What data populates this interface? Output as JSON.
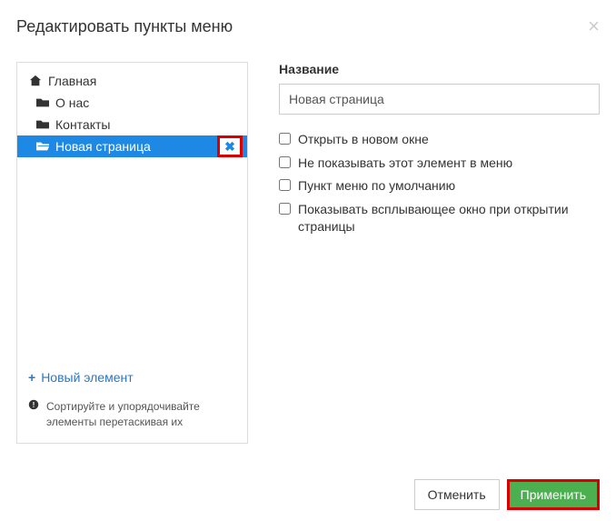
{
  "modal": {
    "title": "Редактировать пункты меню"
  },
  "tree": {
    "items": [
      {
        "label": "Главная"
      },
      {
        "label": "О нас"
      },
      {
        "label": "Контакты"
      },
      {
        "label": "Новая страница"
      }
    ],
    "new_element": "Новый элемент",
    "hint": "Сортируйте и упорядочивайте элементы перетаскивая их"
  },
  "form": {
    "name_label": "Название",
    "name_value": "Новая страница",
    "opt_new_window": "Открыть в новом окне",
    "opt_hide_item": "Не показывать этот элемент в меню",
    "opt_default": "Пункт меню по умолчанию",
    "opt_popup": "Показывать всплывающее окно при открытии страницы"
  },
  "footer": {
    "cancel": "Отменить",
    "apply": "Применить"
  }
}
